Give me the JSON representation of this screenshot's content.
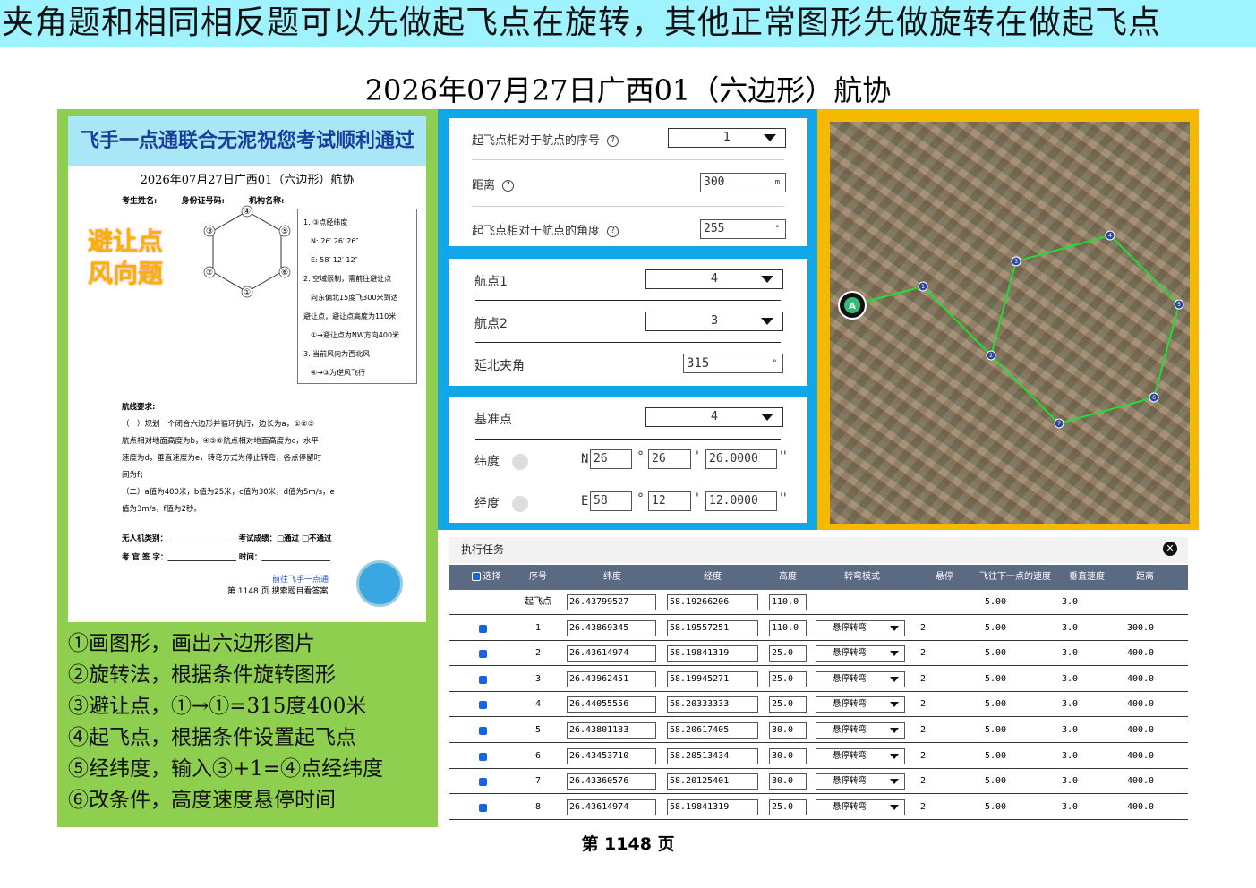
{
  "banner": "夹角题和相同相反题可以先做起飞点在旋转，其他正常图形先做旋转在做起飞点",
  "page_title": "2026年07月27日广西01（六边形）航协",
  "sheet": {
    "header": "飞手一点通联合无泥祝您考试顺利通过",
    "subtitle": "2026年07月27日广西01（六边形）航协",
    "fields": [
      "考生姓名:",
      "身份证号码:",
      "机构名称:"
    ],
    "stamp_line1": "避让点",
    "stamp_line2": "风向题",
    "hex_labels": [
      "④",
      "⑤",
      "⑥",
      "①",
      "②",
      "③"
    ],
    "conditions": [
      "1. ③点经纬度",
      "N: 26′ 26′ 26″",
      "E: 58′ 12′ 12″",
      "2. 空域限制，需前往避让点",
      "向东偏北15度飞300米到达",
      "避让点，避让点高度为110米",
      "①→避让点为NW方向400米",
      "3. 当前风向为西北风",
      "④→③为逆风飞行"
    ],
    "req_title": "航线要求:",
    "req_lines": [
      "（一）规划一个闭合六边形并循环执行，边长为a，①②③",
      "航点相对地面高度为b，④⑤⑥航点相对地面高度为c，水平",
      "速度为d，垂直速度为e，转弯方式为停止转弯，各点停留时",
      "间为f；",
      "（二）a值为400米，b值为25米，c值为30米，d值为5m/s，e",
      "值为3m/s，f值为2秒。"
    ],
    "sign_lines": [
      "无人机类别：__________________    考试成绩：□通过   □不通过",
      "考 官 签 字：__________________  时间：__________________"
    ],
    "foot_line1": "前往飞手一点通",
    "foot_line2": "第 1148 页  搜索题目看答案"
  },
  "steps": [
    "①画图形，画出六边形图片",
    "②旋转法，根据条件旋转图形",
    "③避让点，①→①=315度400米",
    "④起飞点，根据条件设置起飞点",
    "⑤经纬度，输入③+1=④点经纬度",
    "⑥改条件，高度速度悬停时间"
  ],
  "takeoff_card": {
    "seq_label": "起飞点相对于航点的序号",
    "seq_value": "1",
    "dist_label": "距离",
    "dist_value": "300",
    "dist_unit": "m",
    "angle_label": "起飞点相对于航点的角度",
    "angle_value": "255",
    "angle_unit": "°"
  },
  "waypoint_card": {
    "wp1_label": "航点1",
    "wp1_value": "4",
    "wp2_label": "航点2",
    "wp2_value": "3",
    "angle_label": "延北夹角",
    "angle_value": "315",
    "angle_unit": "°"
  },
  "base_card": {
    "base_label": "基准点",
    "base_value": "4",
    "lat_label": "纬度",
    "lat_dir": "N",
    "lat_deg": "26",
    "lat_min": "26",
    "lat_sec": "26.0000",
    "lon_label": "经度",
    "lon_dir": "E",
    "lon_deg": "58",
    "lon_min": "12",
    "lon_sec": "12.0000",
    "deg_sym": "°",
    "min_sym": "'",
    "sec_sym": "''"
  },
  "map": {
    "points": [
      "A",
      "1",
      "2",
      "3",
      "4",
      "5",
      "6",
      "7"
    ],
    "route_color": "#22dd33"
  },
  "task": {
    "title": "执行任务",
    "close": "✕",
    "columns": [
      "选择",
      "序号",
      "纬度",
      "经度",
      "高度",
      "转弯模式",
      "悬停",
      "飞往下一点的速度",
      "垂直速度",
      "距离"
    ],
    "rows": [
      {
        "seq": "起飞点",
        "lat": "26.43799527",
        "lon": "58.19266206",
        "alt": "110.0",
        "turn": "",
        "hover": "",
        "speed": "5.00",
        "vspeed": "3.0",
        "dist": ""
      },
      {
        "seq": "1",
        "lat": "26.43869345",
        "lon": "58.19557251",
        "alt": "110.0",
        "turn": "悬停转弯",
        "hover": "2",
        "speed": "5.00",
        "vspeed": "3.0",
        "dist": "300.0"
      },
      {
        "seq": "2",
        "lat": "26.43614974",
        "lon": "58.19841319",
        "alt": "25.0",
        "turn": "悬停转弯",
        "hover": "2",
        "speed": "5.00",
        "vspeed": "3.0",
        "dist": "400.0"
      },
      {
        "seq": "3",
        "lat": "26.43962451",
        "lon": "58.19945271",
        "alt": "25.0",
        "turn": "悬停转弯",
        "hover": "2",
        "speed": "5.00",
        "vspeed": "3.0",
        "dist": "400.0"
      },
      {
        "seq": "4",
        "lat": "26.44055556",
        "lon": "58.20333333",
        "alt": "25.0",
        "turn": "悬停转弯",
        "hover": "2",
        "speed": "5.00",
        "vspeed": "3.0",
        "dist": "400.0"
      },
      {
        "seq": "5",
        "lat": "26.43801183",
        "lon": "58.20617405",
        "alt": "30.0",
        "turn": "悬停转弯",
        "hover": "2",
        "speed": "5.00",
        "vspeed": "3.0",
        "dist": "400.0"
      },
      {
        "seq": "6",
        "lat": "26.43453710",
        "lon": "58.20513434",
        "alt": "30.0",
        "turn": "悬停转弯",
        "hover": "2",
        "speed": "5.00",
        "vspeed": "3.0",
        "dist": "400.0"
      },
      {
        "seq": "7",
        "lat": "26.43360576",
        "lon": "58.20125401",
        "alt": "30.0",
        "turn": "悬停转弯",
        "hover": "2",
        "speed": "5.00",
        "vspeed": "3.0",
        "dist": "400.0"
      },
      {
        "seq": "8",
        "lat": "26.43614974",
        "lon": "58.19841319",
        "alt": "25.0",
        "turn": "悬停转弯",
        "hover": "2",
        "speed": "5.00",
        "vspeed": "3.0",
        "dist": "400.0"
      }
    ]
  },
  "page_number": "第 1148 页"
}
